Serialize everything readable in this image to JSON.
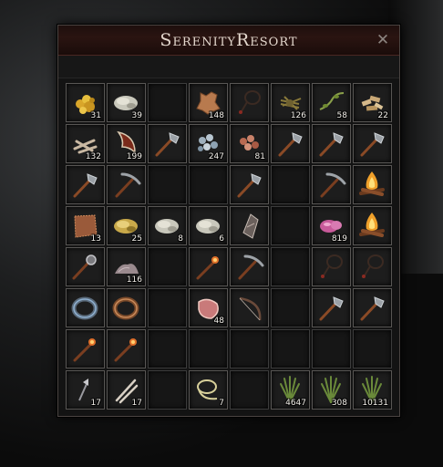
{
  "window": {
    "title": "SerenityResort",
    "close_symbol": "✕"
  },
  "slots": [
    {
      "icon": "gold-nuggets-icon",
      "count": "31"
    },
    {
      "icon": "silver-ore-icon",
      "count": "39"
    },
    {
      "icon": "",
      "count": ""
    },
    {
      "icon": "leather-hide-icon",
      "count": "148"
    },
    {
      "icon": "coiled-rope-icon",
      "count": ""
    },
    {
      "icon": "fiber-bundle-icon",
      "count": "126"
    },
    {
      "icon": "plant-vine-icon",
      "count": "58"
    },
    {
      "icon": "wood-chips-icon",
      "count": "22"
    },
    {
      "icon": "bone-pile-icon",
      "count": "132"
    },
    {
      "icon": "claw-tooth-icon",
      "count": "199"
    },
    {
      "icon": "hatchet-icon",
      "count": ""
    },
    {
      "icon": "stone-pebbles-icon",
      "count": "247"
    },
    {
      "icon": "raw-meat-chunks-icon",
      "count": "81"
    },
    {
      "icon": "hatchet-icon",
      "count": ""
    },
    {
      "icon": "hatchet-icon",
      "count": ""
    },
    {
      "icon": "hatchet-icon",
      "count": ""
    },
    {
      "icon": "hatchet-icon",
      "count": ""
    },
    {
      "icon": "pickaxe-icon",
      "count": ""
    },
    {
      "icon": "",
      "count": ""
    },
    {
      "icon": "",
      "count": ""
    },
    {
      "icon": "hatchet-icon",
      "count": ""
    },
    {
      "icon": "",
      "count": ""
    },
    {
      "icon": "pickaxe-icon",
      "count": ""
    },
    {
      "icon": "campfire-icon",
      "count": ""
    },
    {
      "icon": "hide-scraps-icon",
      "count": "13"
    },
    {
      "icon": "gold-ore-icon",
      "count": "25"
    },
    {
      "icon": "silver-ore-icon",
      "count": "8"
    },
    {
      "icon": "silver-ore-icon",
      "count": "6"
    },
    {
      "icon": "torn-armor-icon",
      "count": ""
    },
    {
      "icon": "",
      "count": ""
    },
    {
      "icon": "pink-crystal-icon",
      "count": "819"
    },
    {
      "icon": "campfire-icon",
      "count": ""
    },
    {
      "icon": "spiked-mace-icon",
      "count": ""
    },
    {
      "icon": "dirt-pile-icon",
      "count": "116"
    },
    {
      "icon": "",
      "count": ""
    },
    {
      "icon": "torch-icon",
      "count": ""
    },
    {
      "icon": "pickaxe-icon",
      "count": ""
    },
    {
      "icon": "",
      "count": ""
    },
    {
      "icon": "coiled-rope-icon",
      "count": ""
    },
    {
      "icon": "coiled-rope-icon",
      "count": ""
    },
    {
      "icon": "blue-ring-icon",
      "count": ""
    },
    {
      "icon": "bronze-ring-icon",
      "count": ""
    },
    {
      "icon": "",
      "count": ""
    },
    {
      "icon": "raw-meat-icon",
      "count": "48"
    },
    {
      "icon": "bow-icon",
      "count": ""
    },
    {
      "icon": "",
      "count": ""
    },
    {
      "icon": "hatchet-icon",
      "count": ""
    },
    {
      "icon": "hatchet-icon",
      "count": ""
    },
    {
      "icon": "torch-icon",
      "count": ""
    },
    {
      "icon": "torch-icon",
      "count": ""
    },
    {
      "icon": "",
      "count": ""
    },
    {
      "icon": "",
      "count": ""
    },
    {
      "icon": "",
      "count": ""
    },
    {
      "icon": "",
      "count": ""
    },
    {
      "icon": "",
      "count": ""
    },
    {
      "icon": "",
      "count": ""
    },
    {
      "icon": "arrowheads-icon",
      "count": "17"
    },
    {
      "icon": "bone-spikes-icon",
      "count": "17"
    },
    {
      "icon": "",
      "count": ""
    },
    {
      "icon": "rope-coil-icon",
      "count": "7"
    },
    {
      "icon": "",
      "count": ""
    },
    {
      "icon": "grass-bundle-icon",
      "count": "4647"
    },
    {
      "icon": "grass-bundle-icon",
      "count": "308"
    },
    {
      "icon": "grass-bundle-icon",
      "count": "10131"
    }
  ]
}
